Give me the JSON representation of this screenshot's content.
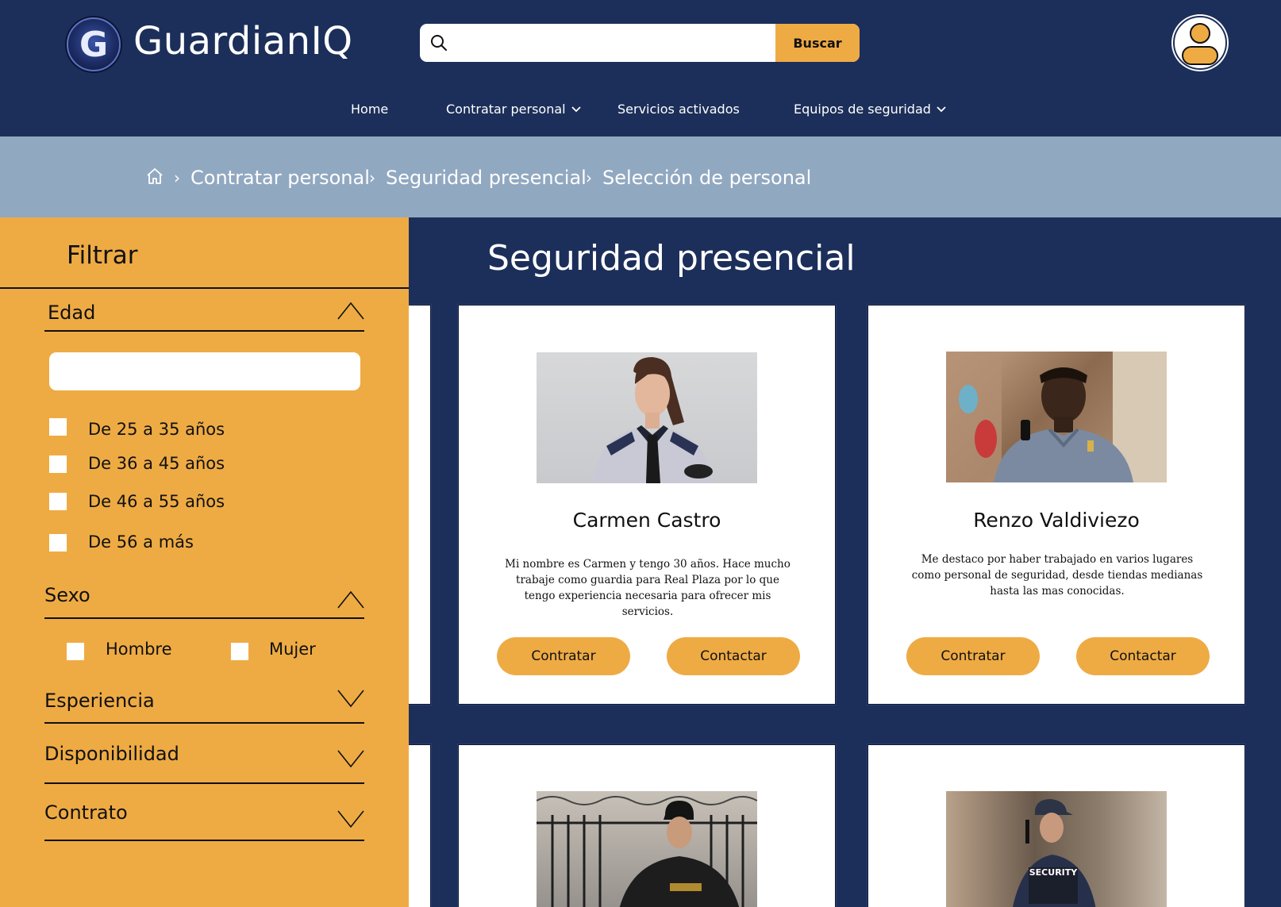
{
  "header": {
    "brand": "GuardianIQ",
    "logo_letter": "G",
    "search": {
      "placeholder": "",
      "value": "",
      "button_label": "Buscar"
    },
    "nav": [
      {
        "label": "Home",
        "has_dropdown": false
      },
      {
        "label": "Contratar personal",
        "has_dropdown": true
      },
      {
        "label": "Servicios activados",
        "has_dropdown": false
      },
      {
        "label": "Equipos de seguridad",
        "has_dropdown": true
      }
    ]
  },
  "breadcrumb": {
    "items": [
      "Contratar personal",
      "Seguridad presencial",
      "Selección de personal"
    ],
    "separator": "›"
  },
  "sidebar": {
    "title": "Filtrar",
    "age": {
      "label": "Edad",
      "input_value": "",
      "options": [
        "De 25 a 35 años",
        "De 36 a 45 años",
        "De 46 a 55 años",
        "De 56 a más"
      ]
    },
    "sex": {
      "label": "Sexo",
      "options": [
        "Hombre",
        "Mujer"
      ]
    },
    "experience": {
      "label": "Esperiencia"
    },
    "availability": {
      "label": "Disponibilidad"
    },
    "contract": {
      "label": "Contrato"
    }
  },
  "main": {
    "title": "Seguridad presencial",
    "cards": [
      {
        "name": "Carmen Castro",
        "description": "Mi nombre es Carmen y tengo 30 años. Hace mucho trabaje como guardia para Real Plaza por lo que tengo experiencia necesaria para ofrecer mis servicios.",
        "hire_label": "Contratar",
        "contact_label": "Contactar"
      },
      {
        "name": "Renzo Valdiviezo",
        "description": "Me destaco por haber trabajado en varios lugares como personal de seguridad, desde tiendas medianas hasta las mas conocidas.",
        "hire_label": "Contratar",
        "contact_label": "Contactar"
      }
    ],
    "photo_badge_text": "SECURITY"
  },
  "colors": {
    "navy": "#1c2f5a",
    "accent": "#eeab44",
    "breadcrumb_bg": "#91a8c1",
    "card_bg": "#ffffff"
  }
}
